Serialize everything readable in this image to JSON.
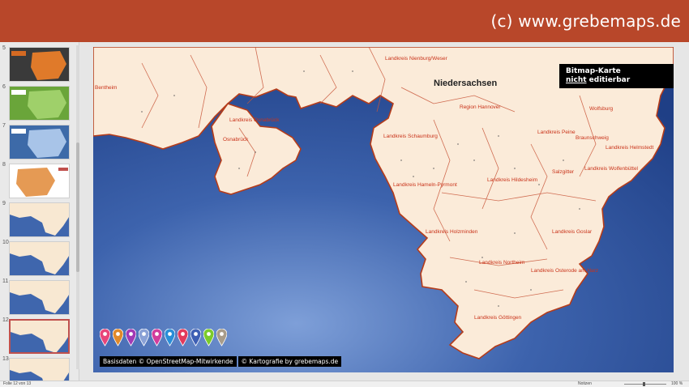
{
  "header": {
    "brand": "(c) www.grebemaps.de",
    "color": "#b8472a"
  },
  "thumbnails": [
    {
      "num": "5",
      "theme": "orange-dark"
    },
    {
      "num": "6",
      "theme": "green"
    },
    {
      "num": "7",
      "theme": "blue"
    },
    {
      "num": "8",
      "theme": "orange-white"
    },
    {
      "num": "9",
      "theme": "cream-blue"
    },
    {
      "num": "10",
      "theme": "cream-blue"
    },
    {
      "num": "11",
      "theme": "cream-blue"
    },
    {
      "num": "12",
      "theme": "cream-blue",
      "active": true
    },
    {
      "num": "13",
      "theme": "cream-blue"
    }
  ],
  "slide": {
    "badge_line1": "Bitmap-Karte",
    "badge_underlined": "nicht",
    "badge_rest": " editierbar",
    "credit_left": "Basisdaten © OpenStreetMap-Mitwirkende",
    "credit_right": "© Kartografie by grebemaps.de",
    "pin_colors": [
      "#e8457a",
      "#e0892a",
      "#a23ab5",
      "#8aa1d6",
      "#d23c9c",
      "#2a8ed8",
      "#e23a5c",
      "#3e5fb4",
      "#7bcb2a",
      "#a89c8a"
    ],
    "map": {
      "region_title": "Niedersachsen",
      "labels": [
        "Landkreis Nienburg/Weser",
        "Landkreis Osnabrück",
        "Osnabrück",
        "Region Hannover",
        "Landkreis Schaumburg",
        "Landkreis Peine",
        "Wolfsburg",
        "Braunschweig",
        "Landkreis Helmstedt",
        "Salzgitter",
        "Landkreis Wolfenbüttel",
        "Landkreis Hildesheim",
        "Landkreis Hameln-Pyrmont",
        "Landkreis Holzminden",
        "Landkreis Goslar",
        "Landkreis Northeim",
        "Landkreis Osterode am Harz",
        "Landkreis Göttingen",
        "Bentheim"
      ]
    }
  },
  "statusbar": {
    "slide_info": "Folie 12 von 13",
    "notes": "Notizen",
    "zoom": "100 %"
  }
}
